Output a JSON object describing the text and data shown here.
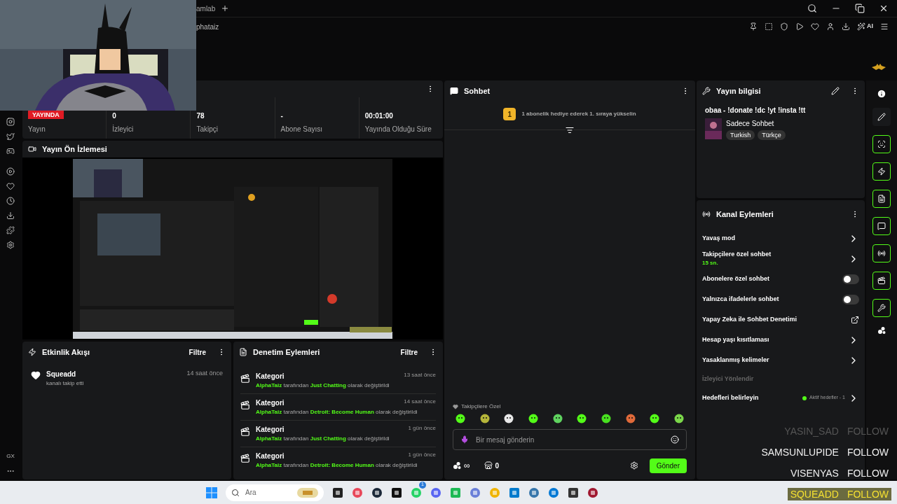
{
  "browser": {
    "tab_title": "amlab",
    "address": "phataiz",
    "ai_label": "AI"
  },
  "sidebar": {
    "footer_label": "GX"
  },
  "stats": [
    {
      "kind": "badge",
      "value": "YAYINDA",
      "label": "Yayın"
    },
    {
      "kind": "plain",
      "value": "0",
      "label": "İzleyici"
    },
    {
      "kind": "plain",
      "value": "78",
      "label": "Takipçi"
    },
    {
      "kind": "plain",
      "value": "-",
      "label": "Abone Sayısı"
    },
    {
      "kind": "plain",
      "value": "00:01:00",
      "label": "Yayında Olduğu Süre"
    }
  ],
  "preview": {
    "title": "Yayın Ön İzlemesi",
    "kind": "picture"
  },
  "events": {
    "title": "Etkinlik Akışı",
    "filter": "Filtre",
    "items": [
      {
        "user": "Squeadd",
        "action": "kanalı takip etti",
        "time": "14 saat önce"
      }
    ]
  },
  "moderation": {
    "title": "Denetim Eylemleri",
    "filter": "Filtre",
    "items": [
      {
        "type": "Kategori",
        "time": "13 saat önce",
        "by": "AlphaTaiz",
        "middle": "tarafından",
        "category": "Just Chatting",
        "end": "olarak değiştirildi"
      },
      {
        "type": "Kategori",
        "time": "14 saat önce",
        "by": "AlphaTaiz",
        "middle": "tarafından",
        "category": "Detroit: Become Human",
        "end": "olarak değiştirildi"
      },
      {
        "type": "Kategori",
        "time": "1 gün önce",
        "by": "AlphaTaiz",
        "middle": "tarafından",
        "category": "Just Chatting",
        "end": "olarak değiştirildi"
      },
      {
        "type": "Kategori",
        "time": "1 gün önce",
        "by": "AlphaTaiz",
        "middle": "tarafından",
        "category": "Detroit: Become Human",
        "end": "olarak değiştirildi"
      }
    ]
  },
  "chat": {
    "title": "Sohbet",
    "rank": "1",
    "promo": "1 abonelik hediye ederek 1. sıraya yükselin",
    "emote_group": "Takipçilere Özel",
    "emotes": [
      {
        "color": "#53fc18"
      },
      {
        "color": "#b5b53a"
      },
      {
        "color": "#e8e8e8"
      },
      {
        "color": "#53fc18"
      },
      {
        "color": "#5fd35f"
      },
      {
        "color": "#53fc18"
      },
      {
        "color": "#48e020"
      },
      {
        "color": "#e06a3a"
      },
      {
        "color": "#53fc18"
      },
      {
        "color": "#7bd84a"
      }
    ],
    "placeholder": "Bir mesaj gönderin",
    "points": "∞",
    "store_count": "0",
    "send": "Gönder"
  },
  "stream_info": {
    "title": "Yayın bilgisi",
    "stream_title": "obaa - !donate !dc !yt !insta !tt",
    "category": "Sadece Sohbet",
    "tags": [
      "Turkish",
      "Türkçe"
    ]
  },
  "channel_actions": {
    "title": "Kanal Eylemleri",
    "items": [
      {
        "kind": "link",
        "label": "Yavaş mod"
      },
      {
        "kind": "link",
        "label": "Takipçilere özel sohbet",
        "detail": "15 sn."
      },
      {
        "kind": "toggle",
        "label": "Abonelere özel sohbet",
        "on": false
      },
      {
        "kind": "toggle",
        "label": "Yalnızca ifadelerle sohbet",
        "on": false
      },
      {
        "kind": "external",
        "label": "Yapay Zeka ile Sohbet Denetimi"
      },
      {
        "kind": "link",
        "label": "Hesap yaşı kısıtlaması"
      },
      {
        "kind": "link",
        "label": "Yasaklanmış kelimeler"
      },
      {
        "kind": "heading",
        "label": "İzleyici Yönlendir"
      },
      {
        "kind": "link",
        "label": "Hedefleri belirleyin",
        "status": "Aktif hedefler - 1"
      }
    ]
  },
  "follow_alerts": [
    {
      "kind": "faded",
      "name": "YASIN_SAD",
      "action": "FOLLOW"
    },
    {
      "kind": "normal",
      "name": "SAMSUNLUPIDE",
      "action": "FOLLOW"
    },
    {
      "kind": "normal",
      "name": "VISENYAS",
      "action": "FOLLOW"
    },
    {
      "kind": "highlight",
      "name": "SQUEADD",
      "action": "FOLLOW"
    }
  ],
  "taskbar": {
    "search_placeholder": "Ara",
    "whatsapp_badge": "1"
  }
}
